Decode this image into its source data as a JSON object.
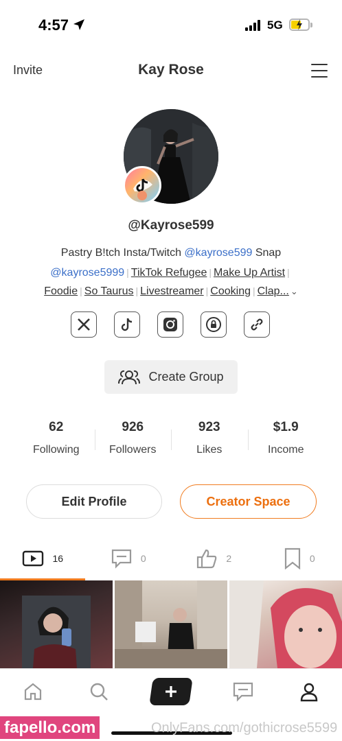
{
  "status_bar": {
    "time": "4:57",
    "network": "5G"
  },
  "header": {
    "invite_label": "Invite",
    "title": "Kay Rose"
  },
  "profile": {
    "handle": "@Kayrose599",
    "bio_line1_text": "Pastry B!tch Insta/Twitch ",
    "bio_line1_link": "@kayrose599",
    "bio_line1_suffix": " Snap",
    "bio_line2_link": "@kayrose5999",
    "bio_line2_tags": [
      "TikTok Refugee",
      "Make Up Artist"
    ],
    "bio_line3_tags": [
      "Foodie",
      "So Taurus",
      "Livestreamer",
      "Cooking",
      "Clap..."
    ],
    "separator": "|",
    "more_glyph": "⌄"
  },
  "socials": [
    {
      "name": "x-icon"
    },
    {
      "name": "tiktok-icon"
    },
    {
      "name": "instagram-icon"
    },
    {
      "name": "onlyfans-icon"
    },
    {
      "name": "link-icon"
    }
  ],
  "group_button_label": "Create Group",
  "stats": [
    {
      "value": "62",
      "label": "Following"
    },
    {
      "value": "926",
      "label": "Followers"
    },
    {
      "value": "923",
      "label": "Likes"
    },
    {
      "value": "$1.9",
      "label": "Income"
    }
  ],
  "buttons": {
    "edit_profile": "Edit Profile",
    "creator_space": "Creator Space"
  },
  "tabs": [
    {
      "icon": "video-icon",
      "count": "16"
    },
    {
      "icon": "comment-icon",
      "count": "0"
    },
    {
      "icon": "thumbs-up-icon",
      "count": "2"
    },
    {
      "icon": "bookmark-icon",
      "count": "0"
    }
  ],
  "colors": {
    "accent": "#f07b1e",
    "link": "#3b6fc8",
    "watermark": "#e0457e"
  },
  "watermark": {
    "left": "fapello.com",
    "right": "OnlyFans.com/gothicrose5599"
  }
}
